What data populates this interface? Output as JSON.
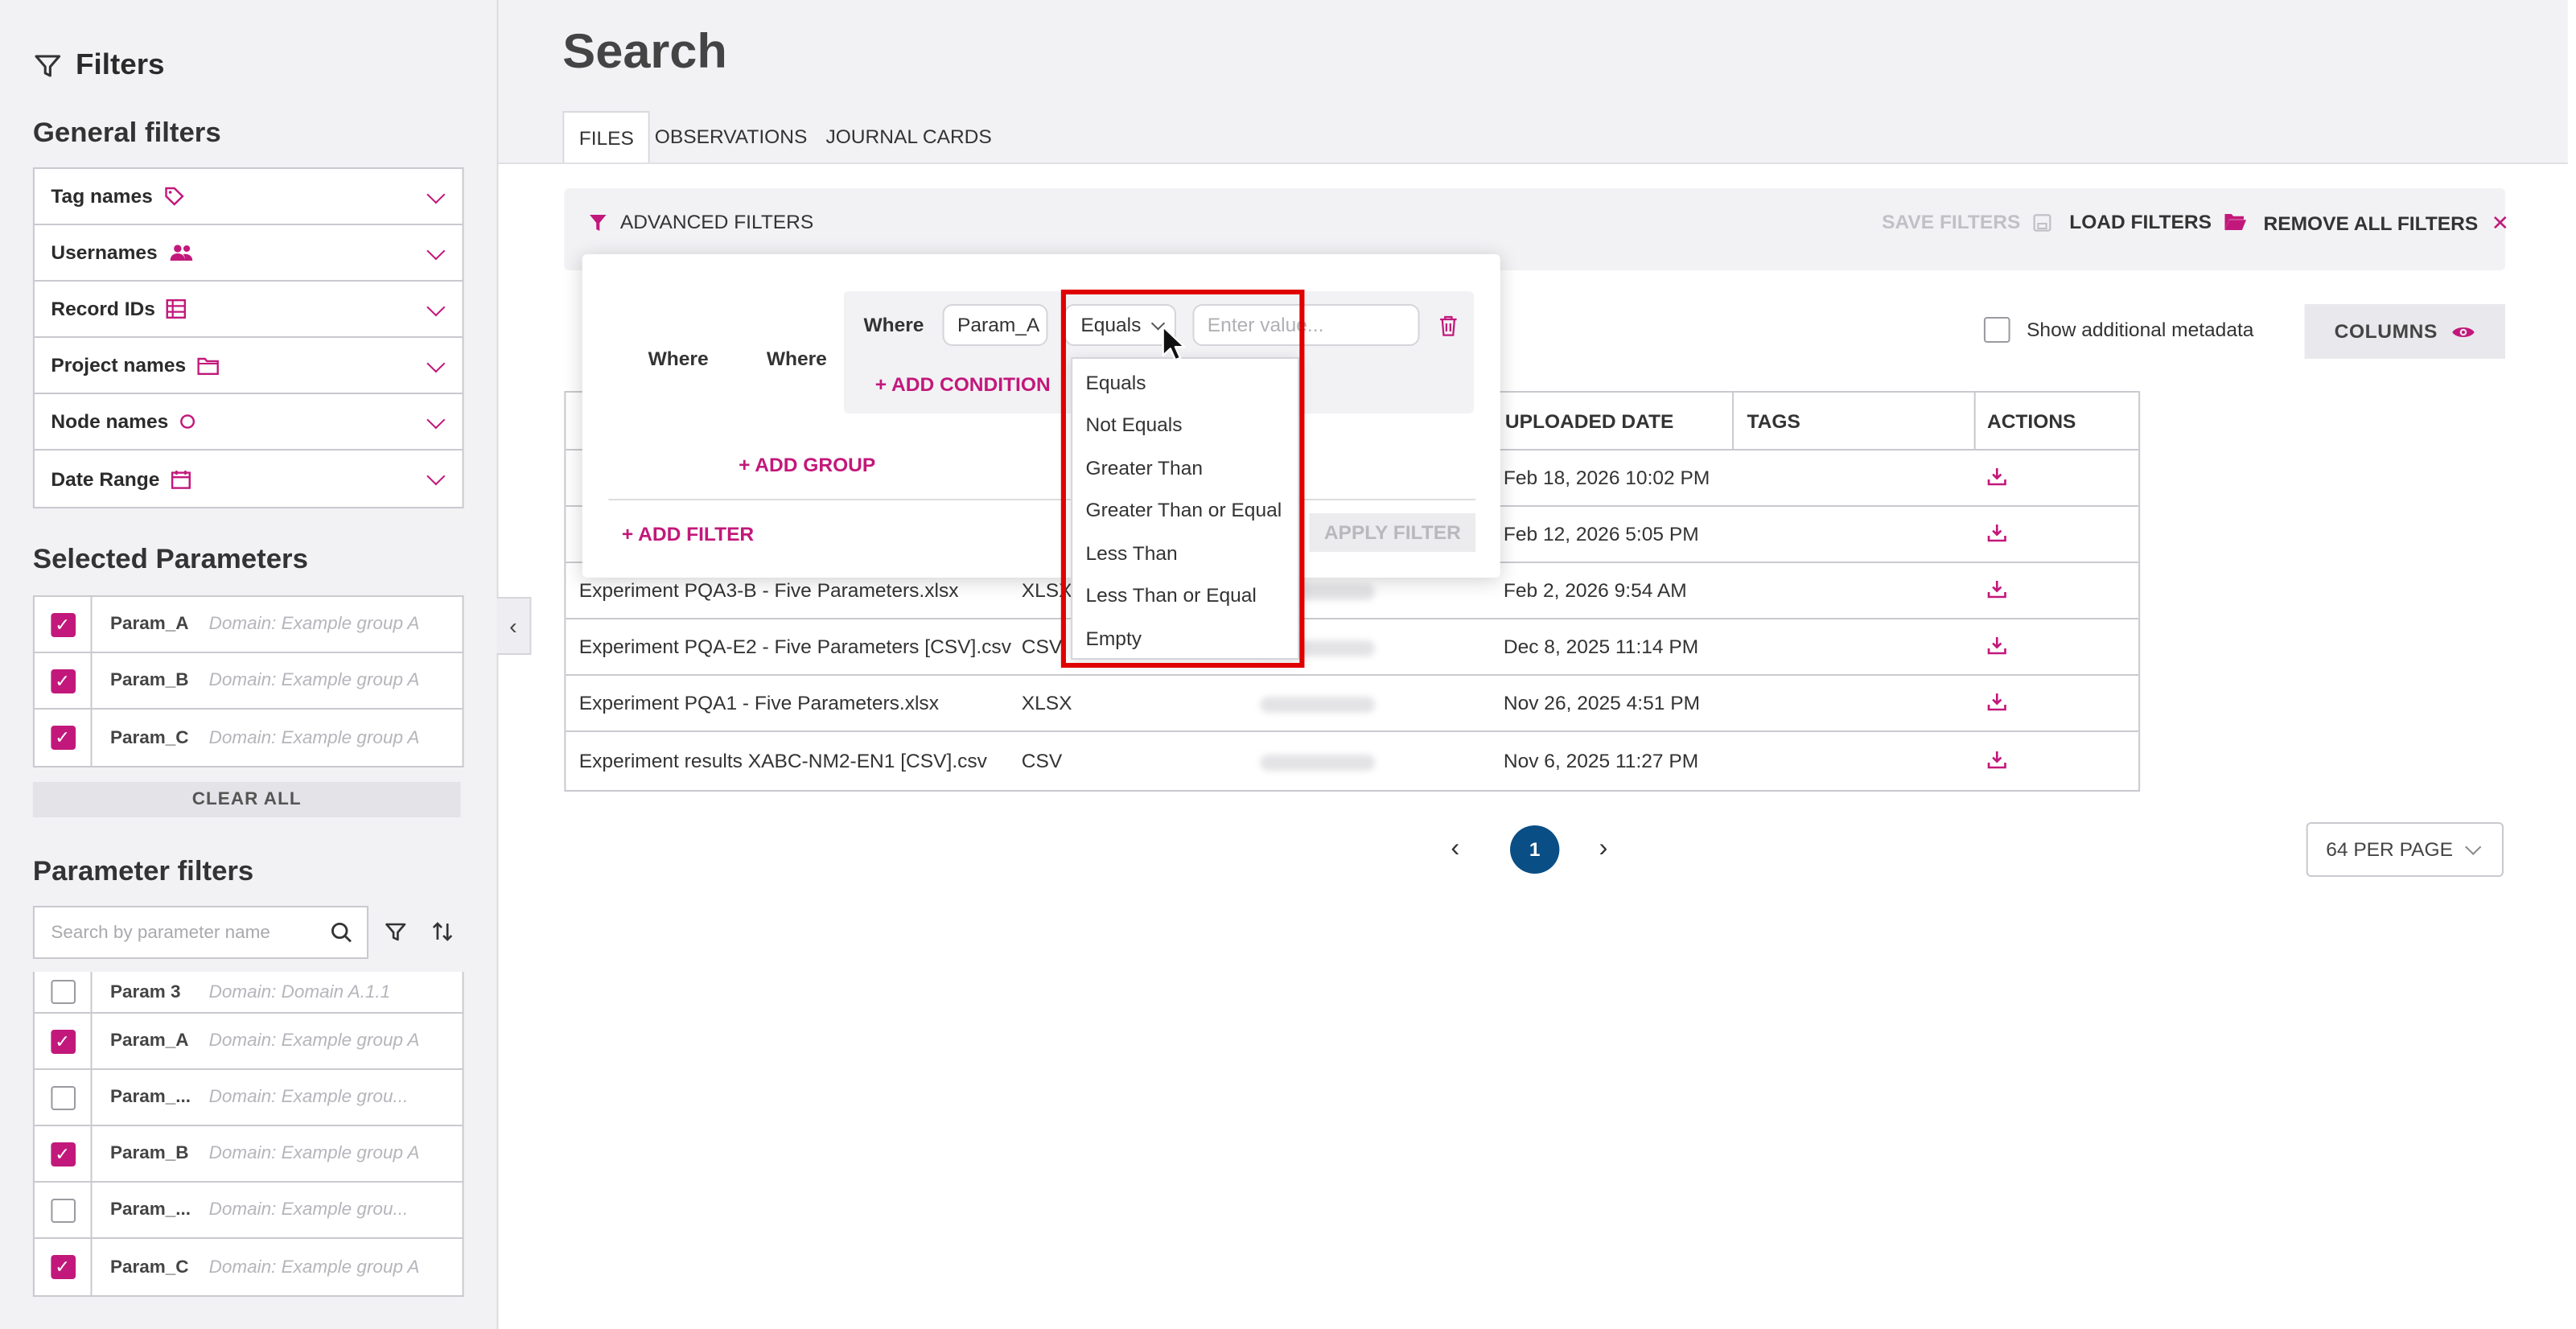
{
  "sidebar": {
    "title": "Filters",
    "general_heading": "General filters",
    "general_filters": [
      {
        "label": "Tag names",
        "icon": "tag-icon"
      },
      {
        "label": "Usernames",
        "icon": "users-icon"
      },
      {
        "label": "Record IDs",
        "icon": "table-icon"
      },
      {
        "label": "Project names",
        "icon": "folder-icon"
      },
      {
        "label": "Node names",
        "icon": "circle-icon"
      },
      {
        "label": "Date Range",
        "icon": "calendar-icon"
      }
    ],
    "selected_heading": "Selected Parameters",
    "selected_params": [
      {
        "name": "Param_A",
        "domain": "Domain: Example group A",
        "checked": true
      },
      {
        "name": "Param_B",
        "domain": "Domain: Example group A",
        "checked": true
      },
      {
        "name": "Param_C",
        "domain": "Domain: Example group A",
        "checked": true
      }
    ],
    "clear_all": "CLEAR ALL",
    "param_filters_heading": "Parameter filters",
    "search_placeholder": "Search by parameter name",
    "param_list": [
      {
        "name": "Param 3",
        "domain": "Domain: Domain A.1.1",
        "checked": false
      },
      {
        "name": "Param_A",
        "domain": "Domain: Example group A",
        "checked": true
      },
      {
        "name": "Param_...",
        "domain": "Domain: Example grou...",
        "checked": false
      },
      {
        "name": "Param_B",
        "domain": "Domain: Example group A",
        "checked": true
      },
      {
        "name": "Param_...",
        "domain": "Domain: Example grou...",
        "checked": false
      },
      {
        "name": "Param_C",
        "domain": "Domain: Example group A",
        "checked": true
      }
    ]
  },
  "main": {
    "title": "Search",
    "tabs": [
      "FILES",
      "OBSERVATIONS",
      "JOURNAL CARDS"
    ],
    "advanced_filters": "ADVANCED FILTERS",
    "save_filters": "SAVE FILTERS",
    "load_filters": "LOAD FILTERS",
    "remove_all_filters": "REMOVE ALL FILTERS",
    "show_metadata": "Show additional metadata",
    "columns_button": "COLUMNS",
    "table": {
      "headers": {
        "uploaded": "UPLOADED DATE",
        "tags": "TAGS",
        "actions": "ACTIONS"
      },
      "rows": [
        {
          "name": "",
          "type": "",
          "date": "Feb 18, 2026 10:02 PM"
        },
        {
          "name": "",
          "type": "",
          "date": "Feb 12, 2026 5:05 PM"
        },
        {
          "name": "Experiment PQA3-B - Five Parameters.xlsx",
          "type": "XLSX",
          "date": "Feb 2, 2026 9:54 AM"
        },
        {
          "name": "Experiment PQA-E2 - Five Parameters [CSV].csv",
          "type": "CSV",
          "date": "Dec 8, 2025 11:14 PM"
        },
        {
          "name": "Experiment PQA1 - Five Parameters.xlsx",
          "type": "XLSX",
          "date": "Nov 26, 2025 4:51 PM"
        },
        {
          "name": "Experiment results XABC-NM2-EN1 [CSV].csv",
          "type": "CSV",
          "date": "Nov 6, 2025 11:27 PM"
        }
      ]
    },
    "pagination": {
      "current": "1",
      "per_page": "64 PER PAGE"
    }
  },
  "filter_popup": {
    "where_1": "Where",
    "where_2": "Where",
    "where_3": "Where",
    "field": "Param_A",
    "operator": "Equals",
    "value_placeholder": "Enter value...",
    "add_condition": "+ ADD CONDITION",
    "add_group": "+ ADD GROUP",
    "add_filter": "+ ADD FILTER",
    "apply_filter": "APPLY FILTER",
    "operator_options": [
      "Equals",
      "Not Equals",
      "Greater Than",
      "Greater Than or Equal",
      "Less Than",
      "Less Than or Equal",
      "Empty"
    ]
  },
  "colors": {
    "accent": "#c2187b",
    "pager": "#0a4e86",
    "highlight": "#e00000"
  }
}
